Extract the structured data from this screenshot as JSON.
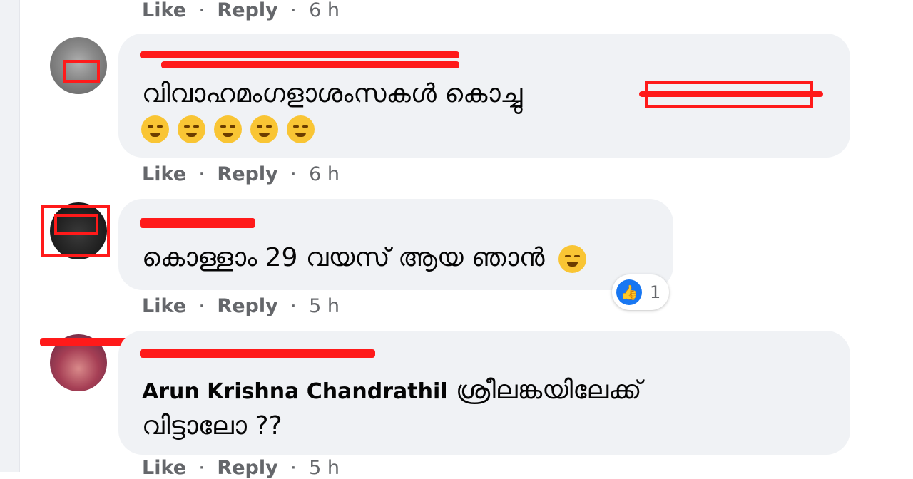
{
  "actions": {
    "like": "Like",
    "reply": "Reply",
    "separator": "·"
  },
  "comments": [
    {
      "time": "6 h"
    },
    {
      "text": "വിവാഹമംഗളാശംസകൾ കൊച്ചു",
      "emoji_icons": [
        "tired-face-emoji",
        "tired-face-emoji",
        "tired-face-emoji",
        "sleepy-face-emoji",
        "sleepy-face-emoji"
      ],
      "time": "6 h"
    },
    {
      "text": "കൊള്ളാം 29 വയസ് ആയ ഞാൻ",
      "emoji_icon": "relieved-face-emoji",
      "reaction": {
        "icon": "like-thumb-icon",
        "count": "1"
      },
      "time": "5 h"
    },
    {
      "mention": "Arun Krishna Chandrathil",
      "text_line1": "ശ്രീലങ്കയിലേക്ക്",
      "text_line2": "വിട്ടാലോ ??",
      "time": "5 h"
    }
  ],
  "colors": {
    "bubble": "#f0f2f5",
    "meta": "#65676b",
    "text": "#050505",
    "redaction": "#ff1a1a",
    "like_blue": "#1877f2"
  }
}
